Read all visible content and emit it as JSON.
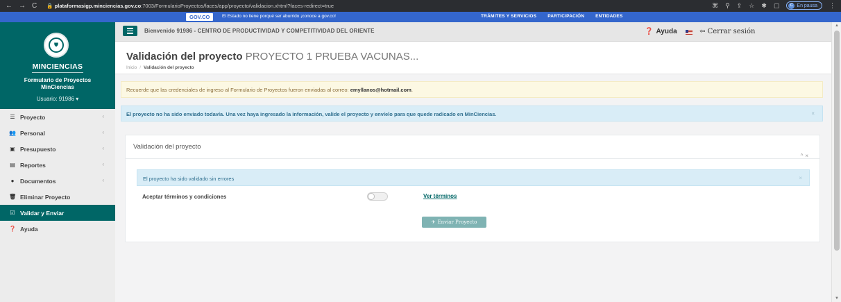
{
  "browser": {
    "url_host": "plataformasigp.minciencias.gov.co",
    "url_path": ":7003/FormularioProyectos/faces/app/proyecto/validacion.xhtml?faces-redirect=true",
    "pause_label": "En pausa",
    "profile_initial": "C"
  },
  "govbar": {
    "logo": "GOV.CO",
    "message": "El Estado no tiene porqué ser aburrido ¡conoce a gov.co!",
    "links": [
      "TRÁMITES Y SERVICIOS",
      "PARTICIPACIÓN",
      "ENTIDADES"
    ]
  },
  "sidebar": {
    "brand_title": "MINCIENCIAS",
    "subtitle_line1": "Formulario de Proyectos",
    "subtitle_line2": "MinCiencias",
    "user_label": "Usuario: 91986 ▾",
    "items": [
      {
        "label": "Proyecto",
        "icon": "list-icon",
        "glyph": "☰",
        "chevron": "‹"
      },
      {
        "label": "Personal",
        "icon": "users-icon",
        "glyph": "👥",
        "chevron": "‹"
      },
      {
        "label": "Presupuesto",
        "icon": "money-icon",
        "glyph": "▣",
        "chevron": "‹"
      },
      {
        "label": "Reportes",
        "icon": "report-icon",
        "glyph": "▤",
        "chevron": "‹"
      },
      {
        "label": "Documentos",
        "icon": "circle-icon",
        "glyph": "●",
        "chevron": "‹"
      },
      {
        "label": "Eliminar Proyecto",
        "icon": "trash-icon",
        "glyph": "🗑",
        "chevron": ""
      },
      {
        "label": "Validar y Enviar",
        "icon": "check-square-icon",
        "glyph": "☑",
        "chevron": ""
      },
      {
        "label": "Ayuda",
        "icon": "question-icon",
        "glyph": "❓",
        "chevron": ""
      }
    ]
  },
  "topbar": {
    "welcome": "Bienvenido 91986 - CENTRO DE PRODUCTIVIDAD Y COMPETITIVIDAD DEL ORIENTE",
    "help": "Ayuda",
    "logout": "Cerrar sesión"
  },
  "heading": {
    "title": "Validación del proyecto",
    "project": "PROYECTO 1 PRUEBA VACUNAS...",
    "crumb_home": "Inicio",
    "crumb_sep": "/",
    "crumb_current": "Validación del proyecto"
  },
  "alerts": {
    "warning_text": "Recuerde que las credenciales de ingreso al Formulario de Proyectos fueron enviadas al correo:",
    "warning_email": "emyllanos@hotmail.com",
    "warning_end": ".",
    "info_text": "El proyecto no ha sido enviado todavía. Una vez haya ingresado la información, valide el proyecto y envíelo para que quede radicado en MinCiencias.",
    "close": "×"
  },
  "panel": {
    "title": "Validación del proyecto",
    "tools": "^ ×",
    "ok_message": "El proyecto ha sido validado sin errores",
    "ok_close": "×",
    "terms_label": "Aceptar términos y condiciones",
    "terms_accepted": false,
    "terms_link": "Ver términos",
    "send_button": "Enviar Proyecto"
  }
}
